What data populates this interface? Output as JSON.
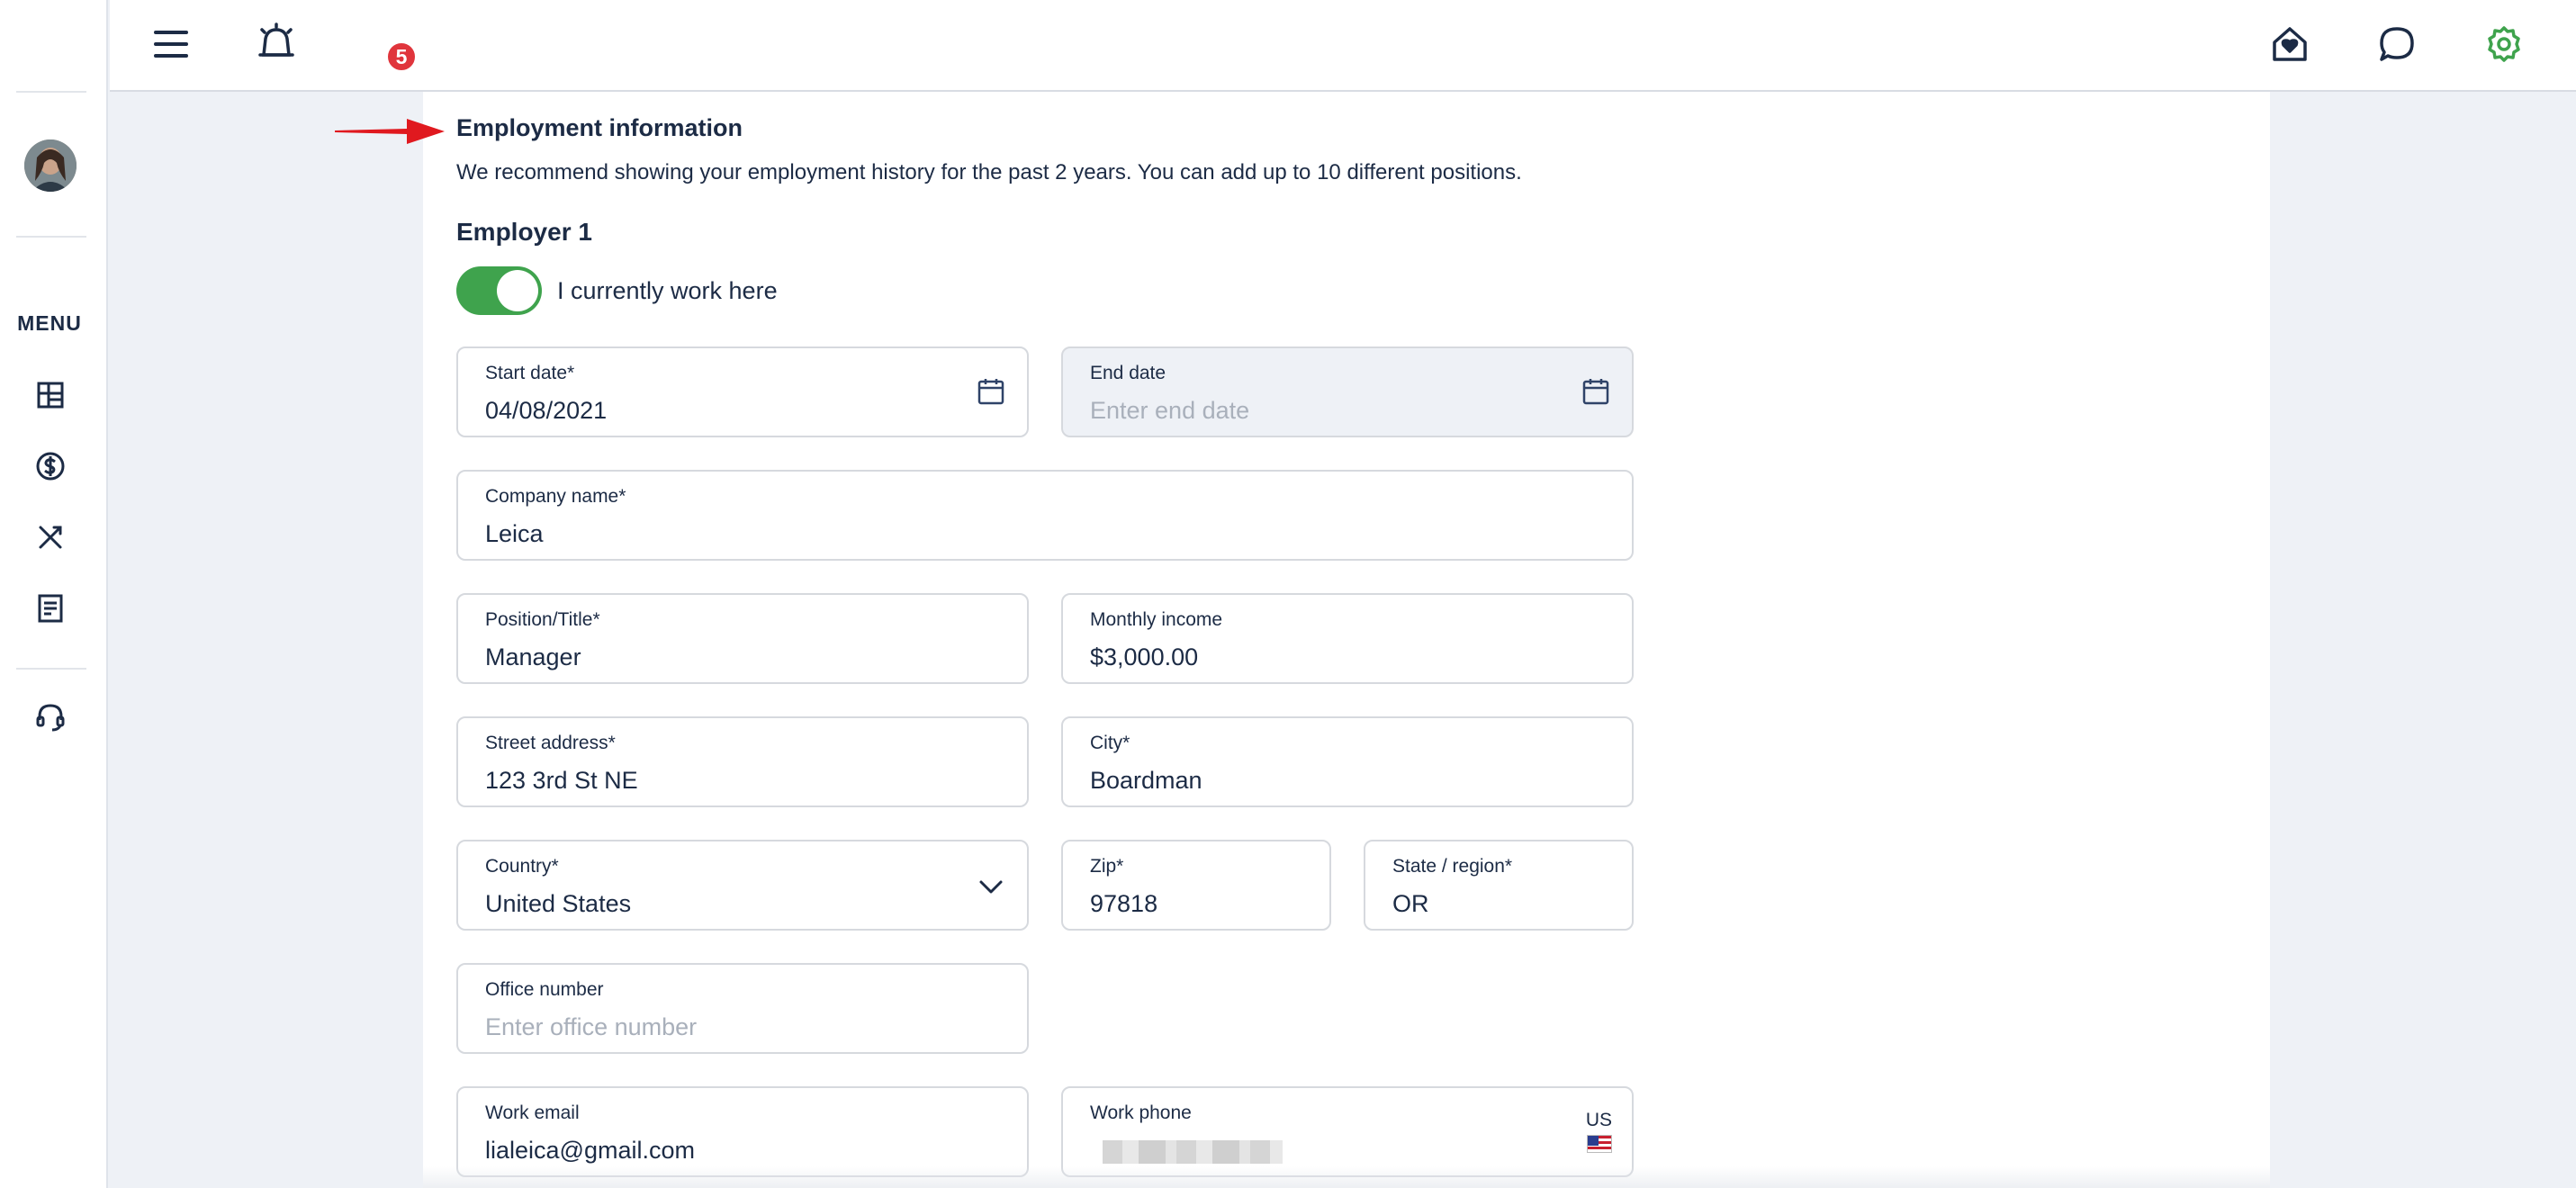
{
  "sidebar": {
    "menu_label": "MENU",
    "items": [
      {
        "icon": "dashboard-icon"
      },
      {
        "icon": "dollar-icon"
      },
      {
        "icon": "tools-icon"
      },
      {
        "icon": "document-icon"
      },
      {
        "icon": "support-headset-icon"
      }
    ]
  },
  "topbar": {
    "notification_count": "5"
  },
  "section": {
    "title": "Employment information",
    "description": "We recommend showing your employment history for the past 2 years. You can add up to 10 different positions."
  },
  "employer": {
    "title": "Employer 1",
    "currently_work_here_label": "I currently work here",
    "currently_work_here": true
  },
  "form": {
    "start_date": {
      "label": "Start date*",
      "value": "04/08/2021"
    },
    "end_date": {
      "label": "End date",
      "placeholder": "Enter end date"
    },
    "company_name": {
      "label": "Company name*",
      "value": "Leica"
    },
    "position": {
      "label": "Position/Title*",
      "value": "Manager"
    },
    "monthly_income": {
      "label": "Monthly income",
      "value": "$3,000.00"
    },
    "street_address": {
      "label": "Street address*",
      "value": "123 3rd St NE"
    },
    "city": {
      "label": "City*",
      "value": "Boardman"
    },
    "country": {
      "label": "Country*",
      "value": "United States"
    },
    "zip": {
      "label": "Zip*",
      "value": "97818"
    },
    "state": {
      "label": "State / region*",
      "value": "OR"
    },
    "office_number": {
      "label": "Office number",
      "placeholder": "Enter office number"
    },
    "work_email": {
      "label": "Work email",
      "value": "lialeica@gmail.com"
    },
    "work_phone": {
      "label": "Work phone",
      "country_code": "US"
    }
  },
  "colors": {
    "accent_green": "#3fa34d",
    "badge_red": "#e0353c",
    "arrow_red": "#e0191f",
    "text_navy": "#1c2b45"
  }
}
